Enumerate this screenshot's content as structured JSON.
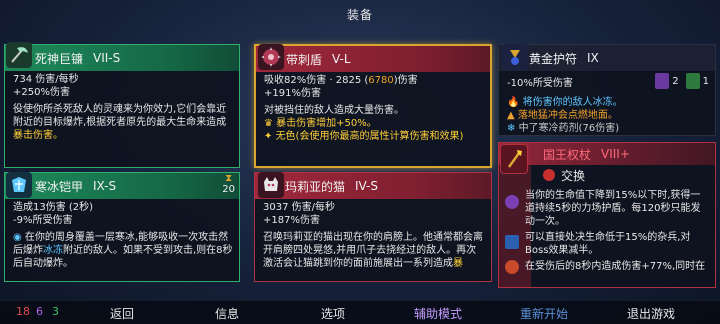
{
  "title": "装备",
  "items": {
    "reaper": {
      "name": "死神巨镰",
      "level": "VII-S",
      "dps": "734 伤害/每秒",
      "bonus": "+250%伤害",
      "desc_plain": "役使你所杀死敌人的灵魂来为你效力,它们会靠近附近的目标爆炸,根据死者原先的最大生命来造成",
      "desc_hl": "暴击伤害。"
    },
    "thorn": {
      "name": "带刺盾",
      "level": "V-L",
      "stat_prefix": "吸收82%伤害 · 2825 (",
      "stat_hl": "6780",
      "stat_suffix": ")伤害",
      "bonus": "+191%伤害",
      "desc": "对被挡住的敌人造成大量伤害。",
      "perk1": "暴击伤害增加+50%。",
      "perk2": "无色(会使用你最高的属性计算伤害和效果)"
    },
    "amulet": {
      "name": "黄金护符",
      "level": "IX",
      "reduction": "-10%所受伤害",
      "count1": "2",
      "count2": "1",
      "perk1": "将伤害你的敌人冰冻。",
      "perk2": "落地猛冲会点燃地面。",
      "perk3": "中了寒冷药剂(76伤害)"
    },
    "armor": {
      "name": "寒冰铠甲",
      "level": "IX-S",
      "timer": "20",
      "stat1": "造成13伤害 (2秒)",
      "stat2": "-9%所受伤害",
      "desc_p1": "在你的周身覆盖一层寒冰,能够吸收一次攻击然后爆炸",
      "desc_hl": "冰冻",
      "desc_p2": "附近的敌人。如果不受到攻击,则在8秒后自动爆炸。"
    },
    "cat": {
      "name": "玛莉亚的猫",
      "level": "IV-S",
      "dps": "3037 伤害/每秒",
      "bonus": "+187%伤害",
      "desc_plain": "召唤玛莉亚的猫出现在你的肩膀上。他通常都会离开肩膀四处晃悠,并用爪子去挠经过的敌人。再次激活会让猫跳到你的面前施展出一系列造成",
      "desc_hl": "暴"
    },
    "scepter": {
      "name": "国王权杖",
      "level": "VIII+",
      "swap": "交换",
      "perk1": "当你的生命值下降到15%以下时,获得一道持续5秒的力场护盾。每120秒只能发动一次。",
      "perk2": "可以直接处决生命低于15%的杂兵,对Boss效果减半。",
      "perk3": "在受伤后的8秒内造成伤害+77%,同时在"
    }
  },
  "stats": {
    "brutality": "18",
    "tactics": "6",
    "survival": "3",
    "colors": {
      "brutality": "#e24b4b",
      "tactics": "#b061e6",
      "survival": "#45c45f"
    }
  },
  "menu": {
    "back": "返回",
    "info": "信息",
    "options": "选项",
    "assist": "辅助模式",
    "restart": "重新开始",
    "quit": "退出游戏"
  }
}
